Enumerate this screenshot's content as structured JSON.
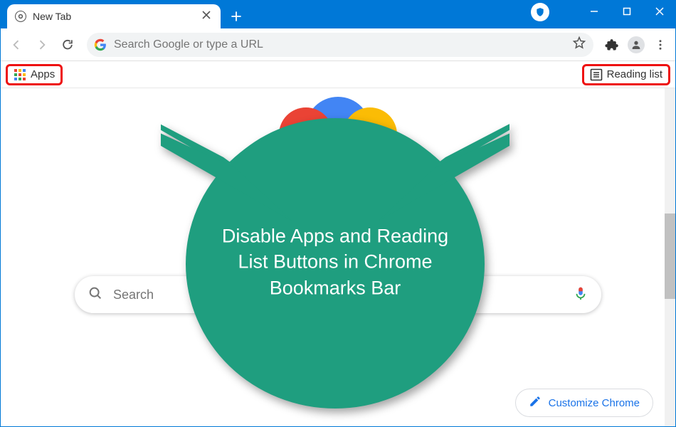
{
  "window": {
    "color": "#0078d7",
    "shield_tooltip": "Browser protection"
  },
  "tab": {
    "title": "New Tab"
  },
  "toolbar": {
    "back_enabled": false,
    "forward_enabled": false,
    "omnibox_placeholder": "Search Google or type a URL",
    "omnibox_value": ""
  },
  "bookmarks": {
    "apps_label": "Apps",
    "reading_list_label": "Reading list"
  },
  "ntp": {
    "search_placeholder": "Search",
    "search_value": "",
    "customize_label": "Customize Chrome"
  },
  "callout": {
    "text": "Disable Apps and Reading List Buttons in Chrome Bookmarks Bar",
    "color": "#1f9e7f"
  }
}
